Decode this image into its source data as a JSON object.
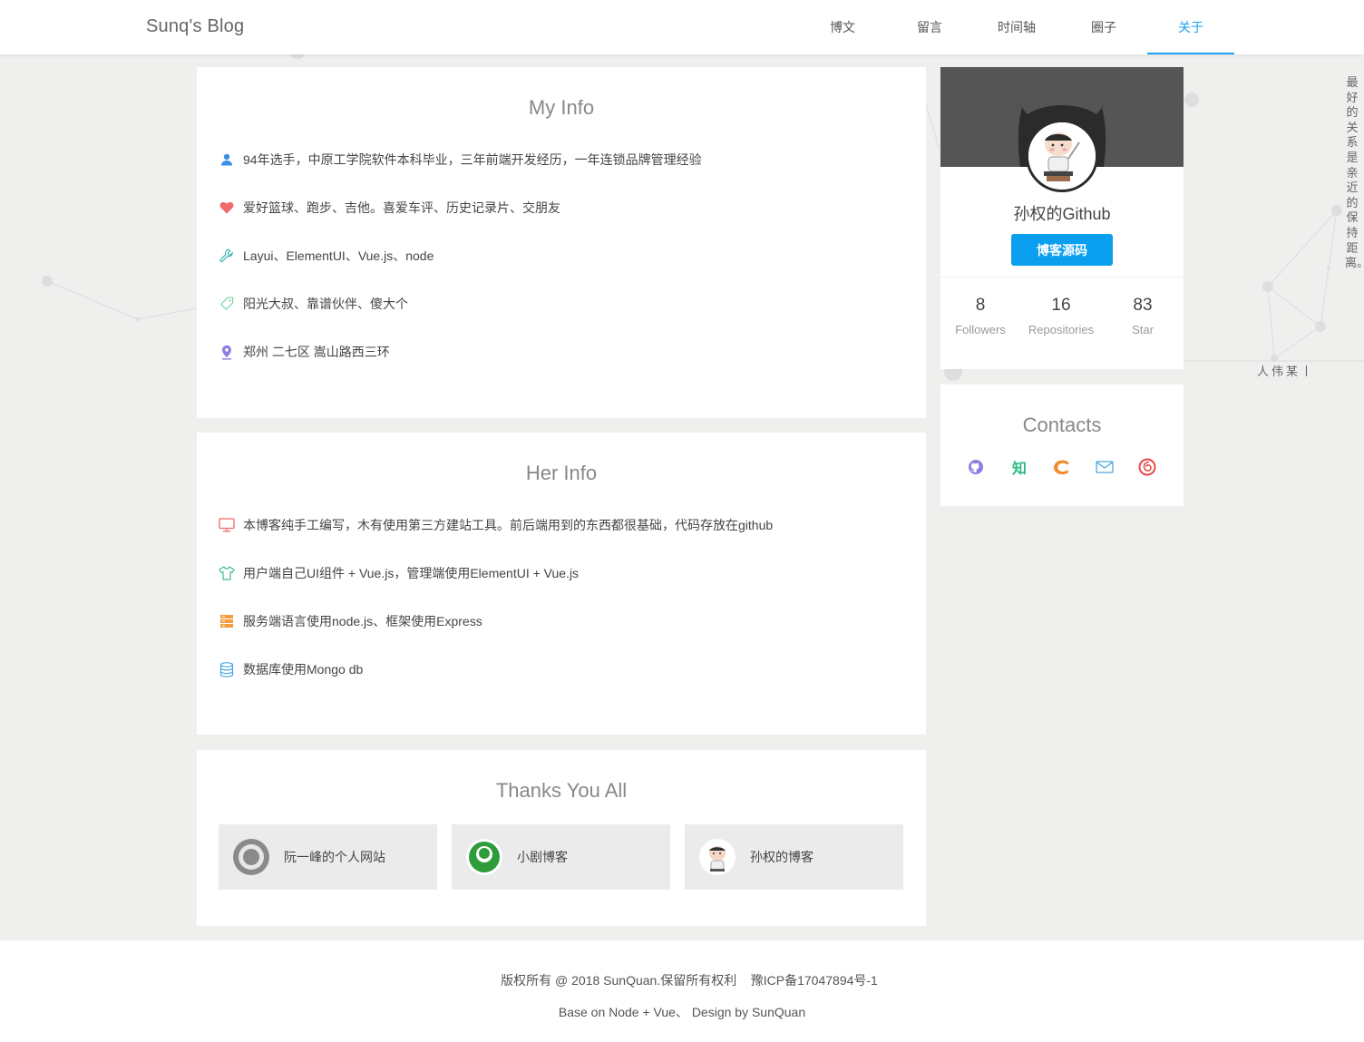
{
  "header": {
    "brand": "Sunq's Blog",
    "nav": [
      "博文",
      "留言",
      "时间轴",
      "圈子",
      "关于"
    ],
    "active": "关于",
    "accent": "#1aa2f5"
  },
  "my_info": {
    "title": "My Info",
    "items": [
      {
        "icon": "user-icon",
        "text": "94年选手，中原工学院软件本科毕业，三年前端开发经历，一年连锁品牌管理经验"
      },
      {
        "icon": "heart-icon",
        "text": "爱好篮球、跑步、吉他。喜爱车评、历史记录片、交朋友"
      },
      {
        "icon": "wrench-icon",
        "text": "Layui、ElementUI、Vue.js、node"
      },
      {
        "icon": "tag-icon",
        "text": "阳光大叔、靠谱伙伴、傻大个"
      },
      {
        "icon": "location-icon",
        "text": "郑州 二七区 嵩山路西三环"
      }
    ]
  },
  "her_info": {
    "title": "Her Info",
    "items": [
      {
        "icon": "monitor-icon",
        "text": "本博客纯手工编写，木有使用第三方建站工具。前后端用到的东西都很基础，代码存放在github"
      },
      {
        "icon": "shirt-icon",
        "text": "用户端自己UI组件 + Vue.js，管理端使用ElementUI + Vue.js"
      },
      {
        "icon": "server-icon",
        "text": "服务端语言使用node.js、框架使用Express"
      },
      {
        "icon": "database-icon",
        "text": "数据库使用Mongo db"
      }
    ]
  },
  "thanks": {
    "title": "Thanks You All",
    "items": [
      "阮一峰的个人网站",
      "小剧博客",
      "孙权的博客"
    ]
  },
  "github": {
    "name": "孙权的Github",
    "button": "博客源码",
    "stats": [
      {
        "num": "8",
        "label": "Followers"
      },
      {
        "num": "16",
        "label": "Repositories"
      },
      {
        "num": "83",
        "label": "Star"
      }
    ]
  },
  "contacts": {
    "title": "Contacts",
    "icons": [
      "github-icon",
      "zhihu-icon",
      "csdn-icon",
      "mail-icon",
      "netease-music-icon"
    ],
    "zhihu_glyph": "知"
  },
  "quote": {
    "text": "最好的关系是亲近的保持距离。",
    "author": "人伟某丨"
  },
  "footer": {
    "line1": "版权所有 @ 2018 SunQuan.保留所有权利    豫ICP备17047894号-1",
    "line2": "Base on Node + Vue、 Design by SunQuan"
  }
}
